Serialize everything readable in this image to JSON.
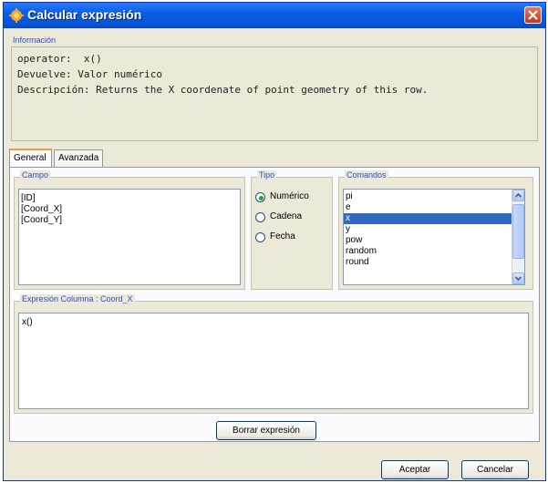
{
  "window": {
    "title": "Calcular expresión"
  },
  "info": {
    "label": "Información",
    "lines": [
      "operator:  x()",
      "Devuelve: Valor numérico",
      "Descripción: Returns the X coordenate of point geometry of this row."
    ]
  },
  "tabs": [
    {
      "label": "General",
      "active": true
    },
    {
      "label": "Avanzada",
      "active": false
    }
  ],
  "campo": {
    "label": "Campo",
    "items": [
      "[ID]",
      "[Coord_X]",
      "[Coord_Y]"
    ]
  },
  "tipo": {
    "label": "Tipo",
    "options": [
      {
        "label": "Numérico",
        "selected": true
      },
      {
        "label": "Cadena",
        "selected": false
      },
      {
        "label": "Fecha",
        "selected": false
      }
    ]
  },
  "comandos": {
    "label": "Comandos",
    "items": [
      "pi",
      "e",
      "x",
      "y",
      "pow",
      "random",
      "round"
    ],
    "selected_index": 2
  },
  "expresion": {
    "label": "Expresión Columna : Coord_X",
    "value": "x()"
  },
  "buttons": {
    "clear": "Borrar expresión",
    "accept": "Aceptar",
    "cancel": "Cancelar"
  },
  "colors": {
    "title_bar": "#0a5ee6",
    "selection": "#316ac5",
    "group_label": "#2b4fcb",
    "radio_dot": "#21a121"
  }
}
